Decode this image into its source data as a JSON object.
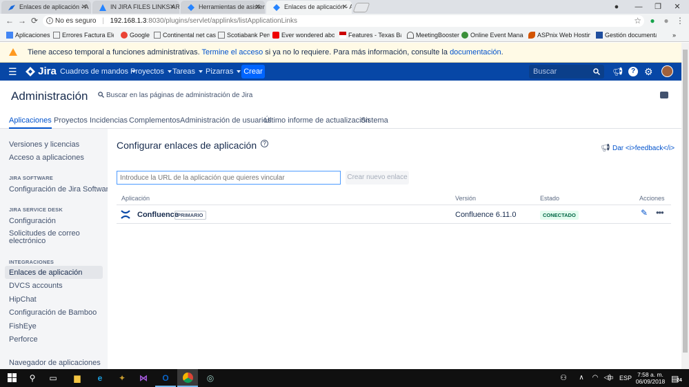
{
  "browser": {
    "tabs": [
      {
        "title": "Enlaces de aplicación - A",
        "active": false
      },
      {
        "title": "IN JIRA FILES LINKS ARE",
        "active": false
      },
      {
        "title": "Herramientas de asisten",
        "active": false
      },
      {
        "title": "Enlaces de aplicación - A",
        "active": true
      }
    ],
    "security_label": "No es seguro",
    "url_host": "192.168.1.3",
    "url_path": ":8030/plugins/servlet/applinks/listApplicationLinks",
    "bookmarks": [
      "Aplicaciones",
      "Errores Factura Electr",
      "Google",
      "Continental net cash",
      "Scotiabank Perú",
      "Ever wondered abou",
      "Features - Texas Bank",
      "MeetingBooster",
      "Online Event Manage",
      "ASPnix Web Hosting",
      "Gestión documental"
    ]
  },
  "banner": {
    "text_before": "Tiene acceso temporal a funciones administrativas.",
    "link1": "Termine el acceso",
    "text_mid": "si ya no lo requiere. Para más información, consulte la",
    "link2": "documentación",
    "text_end": "."
  },
  "jira_nav": {
    "logo": "Jira",
    "items": [
      "Cuadros de mandos",
      "Proyectos",
      "Tareas",
      "Pizarras"
    ],
    "create_label": "Crear",
    "search_placeholder": "Buscar"
  },
  "admin": {
    "title": "Administración",
    "search_hint": "Buscar en las páginas de administración de Jira",
    "tabs": [
      "Aplicaciones",
      "Proyectos",
      "Incidencias",
      "Complementos",
      "Administración de usuarios",
      "Último informe de actualización",
      "Sistema"
    ],
    "active_tab": "Aplicaciones"
  },
  "sidebar": {
    "group1": [
      "Versiones y licencias",
      "Acceso a aplicaciones"
    ],
    "jira_software_header": "JIRA SOFTWARE",
    "jira_software": [
      "Configuración de Jira Software"
    ],
    "jira_service_desk_header": "JIRA SERVICE DESK",
    "jira_service_desk": [
      "Configuración",
      "Solicitudes de correo electrónico"
    ],
    "integraciones_header": "INTEGRACIONES",
    "integraciones": [
      "Enlaces de aplicación",
      "DVCS accounts",
      "HipChat",
      "Configuración de Bamboo",
      "FishEye",
      "Perforce"
    ],
    "navegador": "Navegador de aplicaciones"
  },
  "main": {
    "title": "Configurar enlaces de aplicación",
    "feedback": "Dar <i>feedback</i>",
    "url_placeholder": "Introduce la URL de la aplicación que quieres vincular",
    "create_link_button": "Crear nuevo enlace",
    "columns": {
      "app": "Aplicación",
      "version": "Versión",
      "state": "Estado",
      "actions": "Acciones"
    },
    "rows": [
      {
        "app": "Confluence",
        "badge": "PRIMARIO",
        "version": "Confluence 6.11.0",
        "state": "CONECTADO"
      }
    ]
  },
  "taskbar": {
    "language": "ESP",
    "time": "7:58 a. m.",
    "date": "06/09/2018",
    "notification_count": "24"
  },
  "colors": {
    "jira_nav": "#0747a6",
    "create": "#0065ff",
    "link": "#0052cc",
    "banner_bg": "#fffae6",
    "warning": "#ff991f",
    "connected": "#006644"
  }
}
